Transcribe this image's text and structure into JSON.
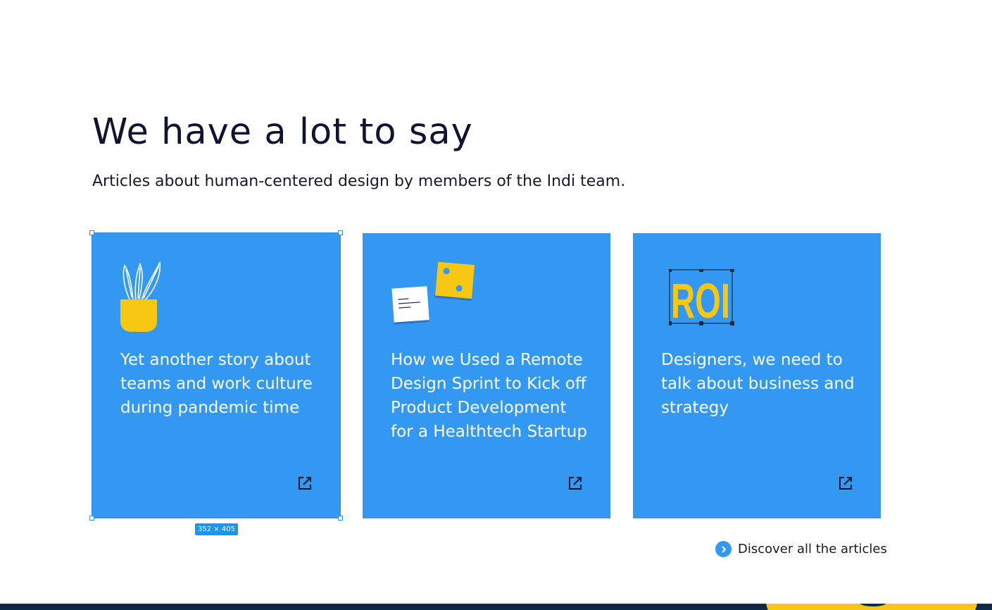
{
  "section": {
    "heading": "We have a lot to say",
    "subheading": "Articles about human-centered design by members of the Indi team."
  },
  "cards": [
    {
      "title": "Yet another story about teams and work culture during pandemic time",
      "illustration": "plant-pot-icon",
      "action_icon": "external-link-icon"
    },
    {
      "title": "How we Used a Remote Design Sprint to Kick off Product Development for a Healthtech Startup",
      "illustration": "sticky-notes-icon",
      "action_icon": "external-link-icon"
    },
    {
      "title": "Designers, we need to talk about business and strategy",
      "illustration": "roi-text-icon",
      "illustration_text": "ROI",
      "action_icon": "external-link-icon"
    }
  ],
  "selection": {
    "size_label": "352 × 405"
  },
  "discover": {
    "label": "Discover all the articles",
    "icon": "chevron-right-icon"
  },
  "colors": {
    "card_bg": "#3398f1",
    "accent_yellow": "#f7c713",
    "heading_text": "#0f1530",
    "footer_bg": "#0e2a45",
    "selection_blue": "#2b8ef0"
  }
}
